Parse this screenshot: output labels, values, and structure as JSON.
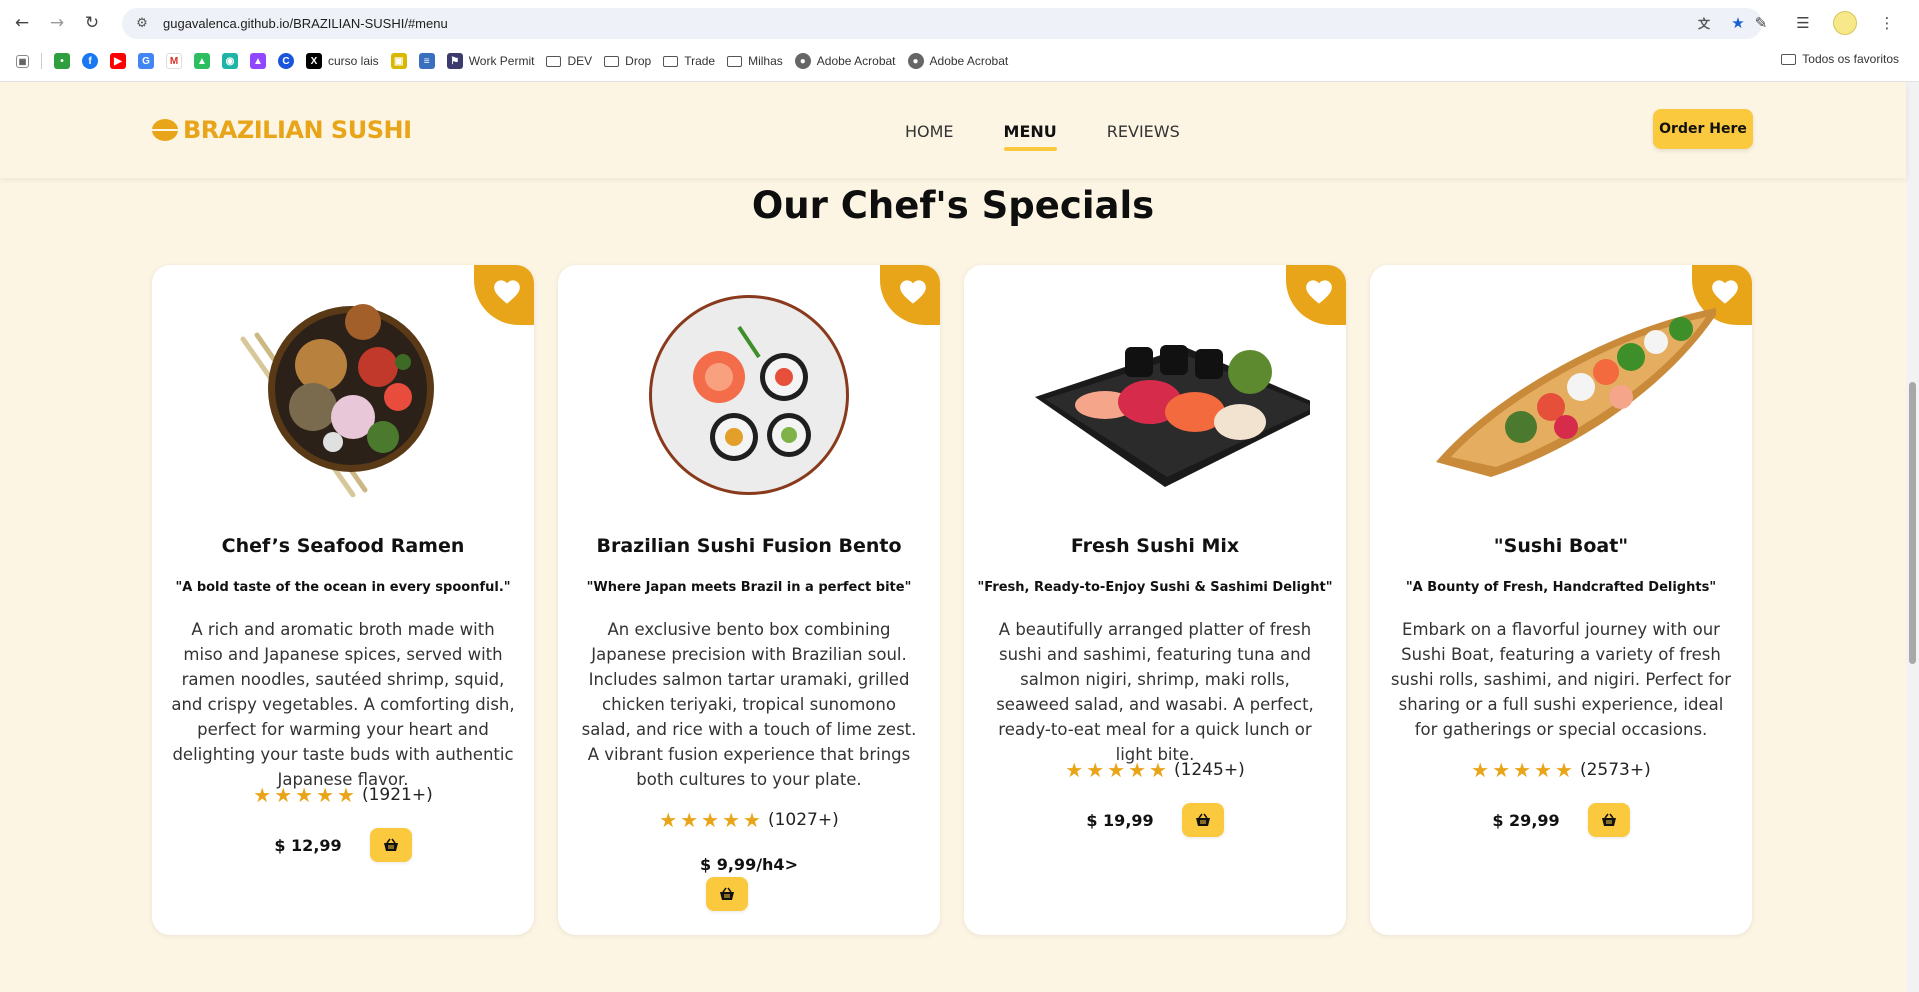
{
  "browser": {
    "url": "gugavalenca.github.io/BRAZILIAN-SUSHI/#menu",
    "bookmarks": [
      {
        "label": "",
        "icon": "apps-grid-icon"
      },
      {
        "label": "",
        "icon": "gauge-icon"
      },
      {
        "label": "",
        "icon": "facebook-icon"
      },
      {
        "label": "",
        "icon": "youtube-icon"
      },
      {
        "label": "",
        "icon": "translate-icon"
      },
      {
        "label": "",
        "icon": "gmail-icon"
      },
      {
        "label": "",
        "icon": "evernote-icon"
      },
      {
        "label": "",
        "icon": "camera-icon"
      },
      {
        "label": "",
        "icon": "twitch-icon"
      },
      {
        "label": "",
        "icon": "c-icon"
      },
      {
        "label": "curso lais",
        "icon": "x-icon"
      },
      {
        "label": "",
        "icon": "card-icon"
      },
      {
        "label": "",
        "icon": "document-icon"
      },
      {
        "label": "Work Permit",
        "icon": "flag-icon"
      },
      {
        "label": "DEV",
        "icon": "folder-icon"
      },
      {
        "label": "Drop",
        "icon": "folder-icon"
      },
      {
        "label": "Trade",
        "icon": "folder-icon"
      },
      {
        "label": "Milhas",
        "icon": "folder-icon"
      },
      {
        "label": "Adobe Acrobat",
        "icon": "globe-icon"
      },
      {
        "label": "Adobe Acrobat",
        "icon": "globe-icon"
      }
    ],
    "all_bookmarks": "Todos os favoritos"
  },
  "header": {
    "logo": "BRAZILIAN SUSHI",
    "nav": [
      "HOME",
      "MENU",
      "REVIEWS"
    ],
    "active_nav": "MENU",
    "order_button": "Order Here"
  },
  "section": {
    "title": "Our Chef's Specials"
  },
  "cards": [
    {
      "name": "Chef’s Seafood Ramen",
      "tagline": "\"A bold taste of the ocean in every spoonful.\"",
      "description": "A rich and aromatic broth made with miso and Japanese spices, served with ramen noodles, sautéed shrimp, squid, and crispy vegetables. A comforting dish, perfect for warming your heart and delighting your taste buds with authentic Japanese flavor.",
      "stars": 5,
      "reviews": "(1921+)",
      "price": "$ 12,99",
      "image": "ramen-bowl-image"
    },
    {
      "name": "Brazilian Sushi Fusion Bento",
      "tagline": "\"Where Japan meets Brazil in a perfect bite\"",
      "description": "An exclusive bento box combining Japanese precision with Brazilian soul. Includes salmon tartar uramaki, grilled chicken teriyaki, tropical sunomono salad, and rice with a touch of lime zest. A vibrant fusion experience that brings both cultures to your plate.",
      "stars": 5,
      "reviews": "(1027+)",
      "price": "$ 9,99/h4>",
      "image": "sushi-plate-image"
    },
    {
      "name": "Fresh Sushi Mix",
      "tagline": "\"Fresh, Ready-to-Enjoy Sushi & Sashimi Delight\"",
      "description": "A beautifully arranged platter of fresh sushi and sashimi, featuring tuna and salmon nigiri, shrimp, maki rolls, seaweed salad, and wasabi. A perfect, ready-to-eat meal for a quick lunch or light bite.",
      "stars": 5,
      "reviews": "(1245+)",
      "price": "$ 19,99",
      "image": "sushi-tray-image"
    },
    {
      "name": "\"Sushi Boat\"",
      "tagline": "\"A Bounty of Fresh, Handcrafted Delights\"",
      "description": "Embark on a flavorful journey with our Sushi Boat, featuring a variety of fresh sushi rolls, sashimi, and nigiri. Perfect for sharing or a full sushi experience, ideal for gatherings or special occasions.",
      "stars": 5,
      "reviews": "(2573+)",
      "price": "$ 29,99",
      "image": "sushi-boat-image"
    }
  ],
  "colors": {
    "accent": "#e9a519",
    "button": "#fbc93d",
    "background": "#fdf5e4"
  }
}
